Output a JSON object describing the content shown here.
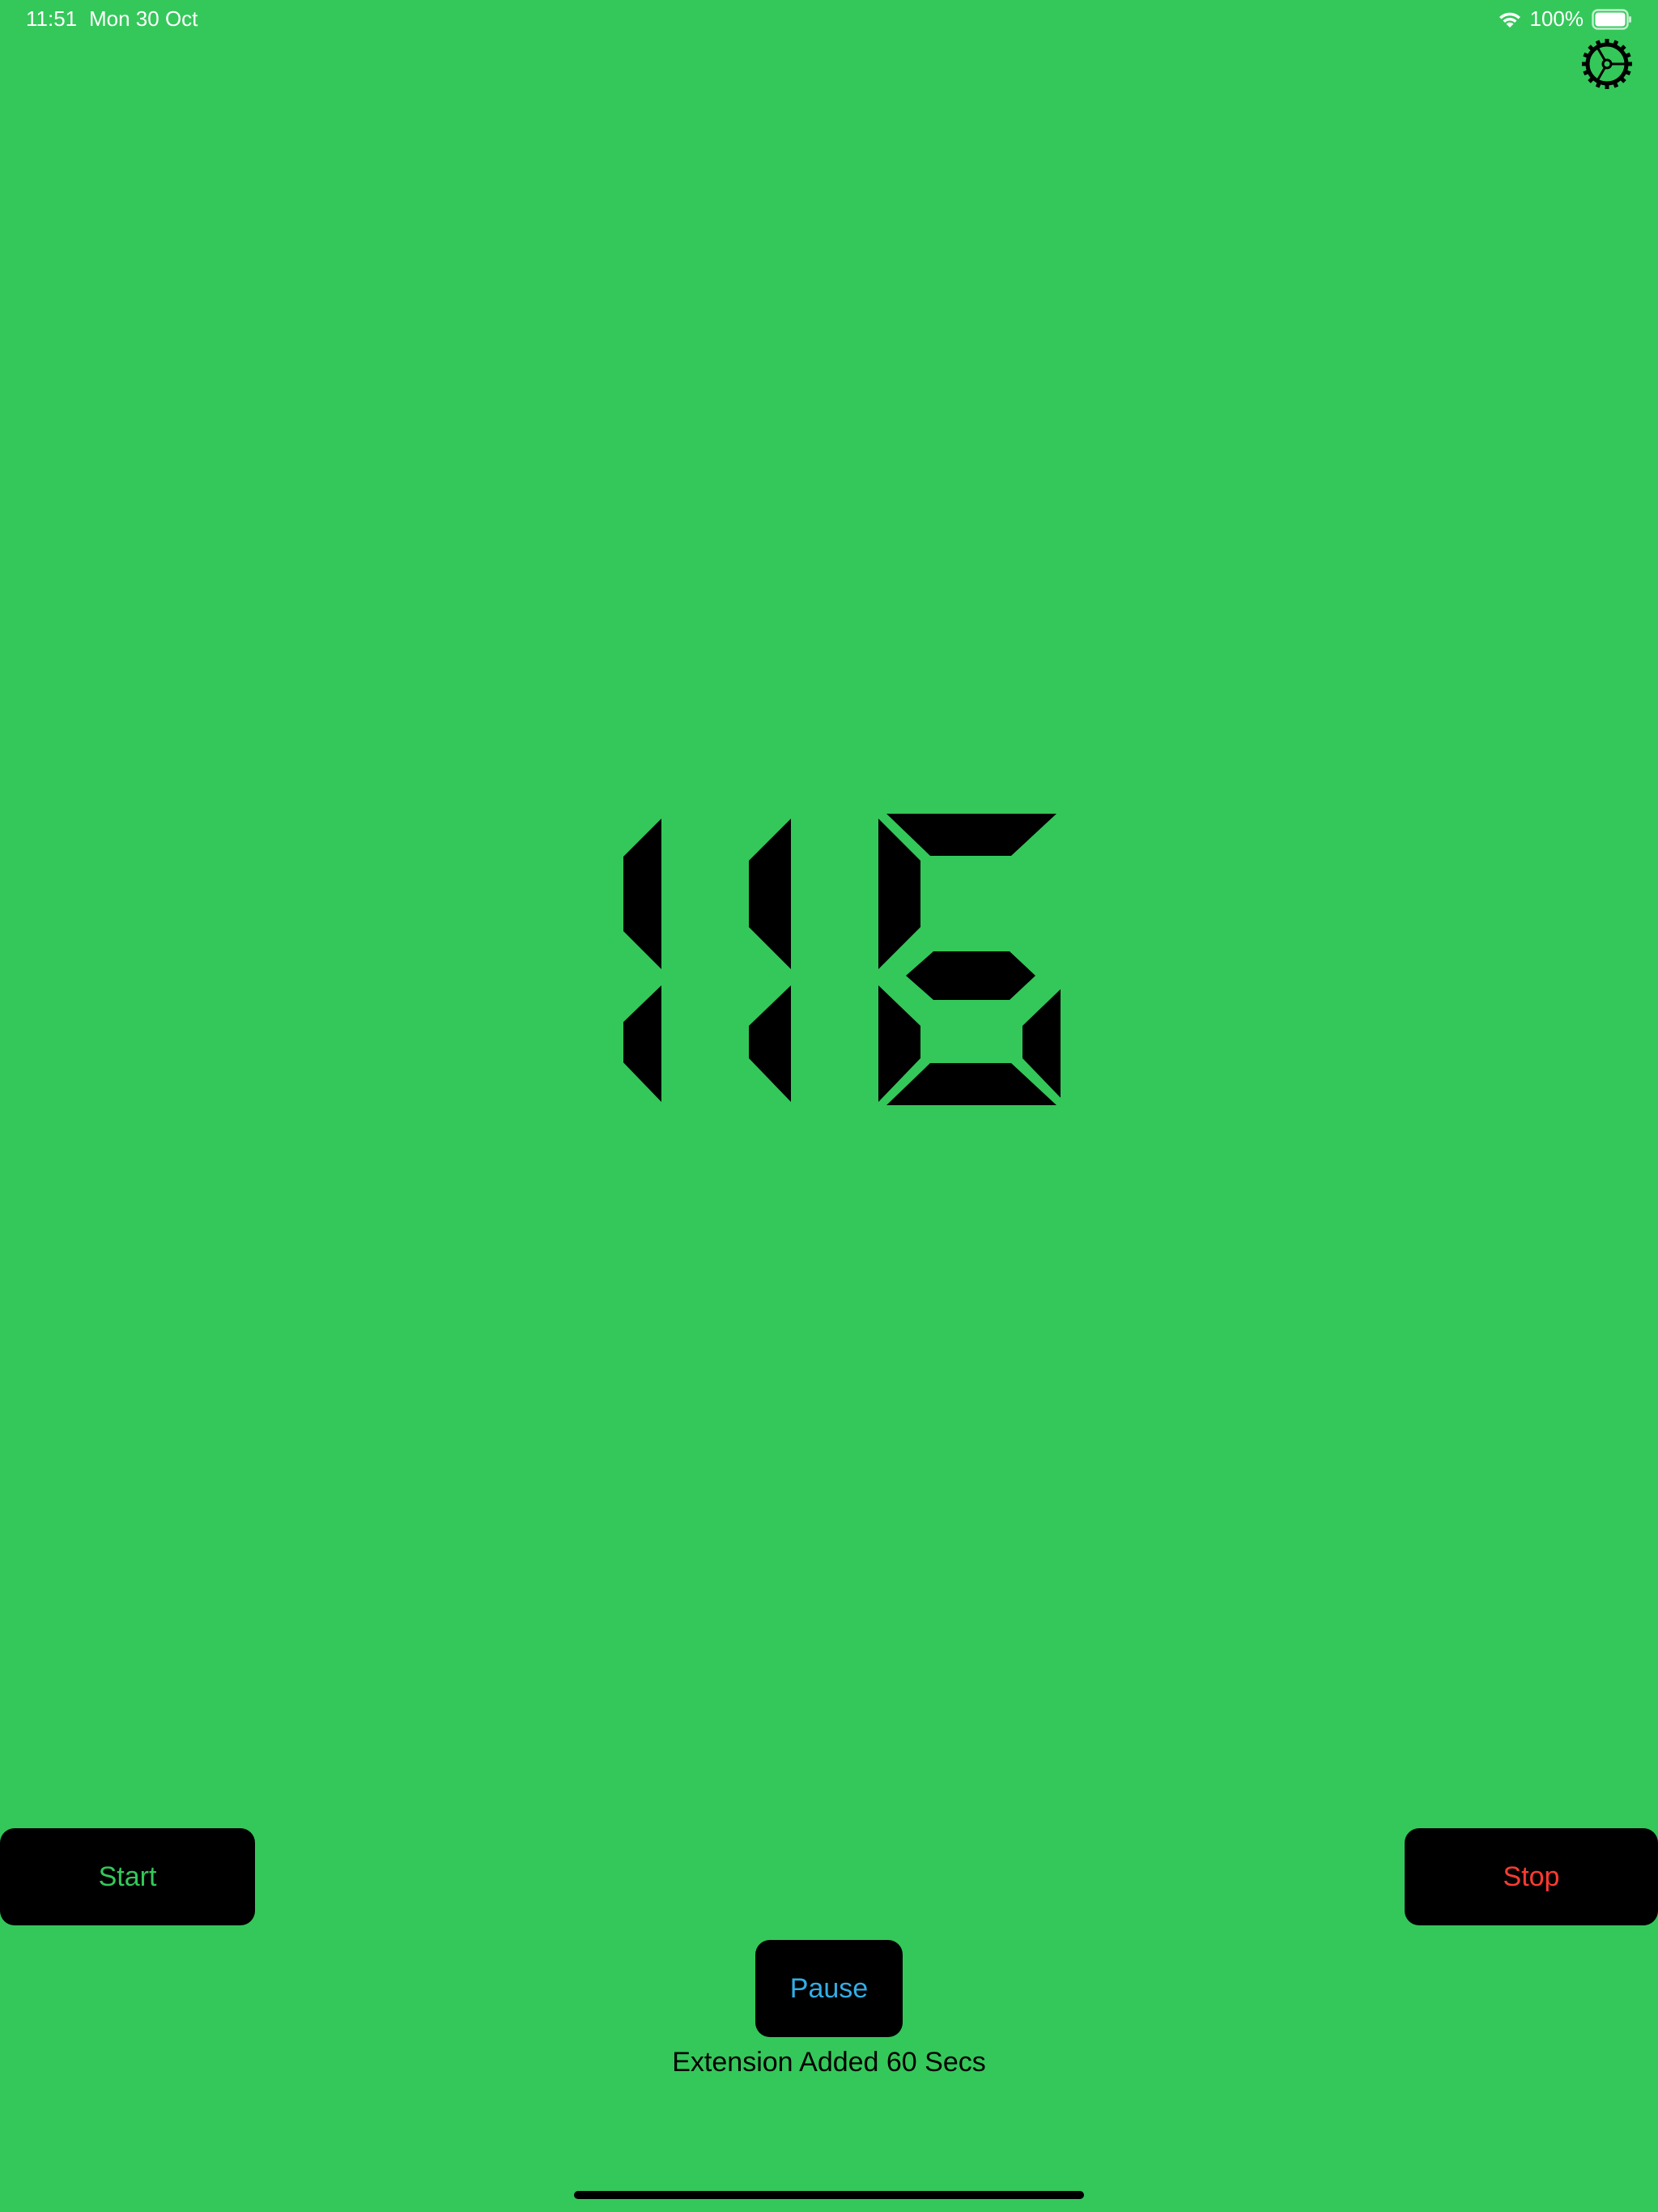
{
  "status_bar": {
    "time": "11:51",
    "date": "Mon 30 Oct",
    "battery": "100%"
  },
  "timer": {
    "value": "116"
  },
  "buttons": {
    "start_label": "Start",
    "stop_label": "Stop",
    "pause_label": "Pause"
  },
  "message": "Extension Added 60 Secs",
  "colors": {
    "background": "#34c85a",
    "start_text": "#34c85a",
    "stop_text": "#ff3b30",
    "pause_text": "#32ade6",
    "button_bg": "#000000"
  },
  "icons": {
    "settings": "gear-icon",
    "wifi": "wifi-icon",
    "battery": "battery-icon"
  }
}
